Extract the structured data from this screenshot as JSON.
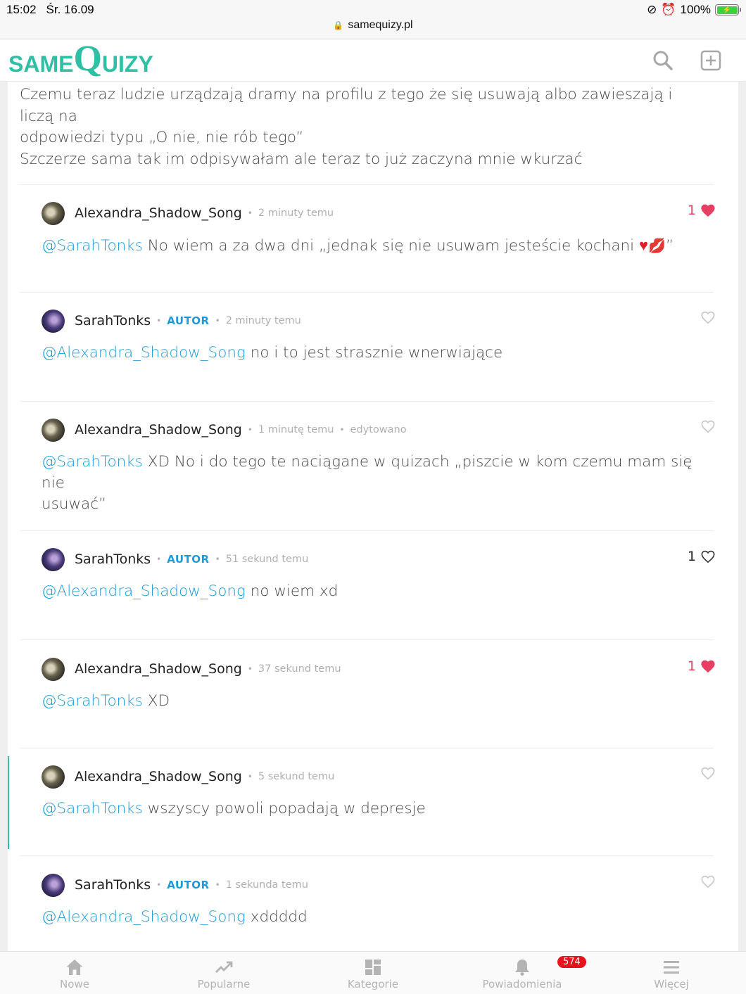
{
  "status_bar": {
    "time": "15:02",
    "date": "Śr. 16.09",
    "battery": "100%",
    "url": "samequizy.pl"
  },
  "header": {
    "logo_same": "SAME",
    "logo_q": "Q",
    "logo_uizy": "UIZY",
    "brand_color": "#2fbfa5"
  },
  "post": {
    "lines": [
      "Czemu teraz ludzie urządzają dramy na profilu z tego że się usuwają albo zawieszają i liczą na",
      "odpowiedzi typu „O nie, nie rób tego”",
      "Szczerze sama tak im odpisywałam ale teraz to już zaczyna mnie wkurzać"
    ]
  },
  "comments": [
    {
      "author": "Alexandra_Shadow_Song",
      "time": "2 minuty temu",
      "mention": "@SarahTonks",
      "text": " No wiem a za dwa dni „jednak się nie usuwam jesteście kochani ",
      "text_end": "”",
      "likes": "1",
      "liked": true
    },
    {
      "author": "SarahTonks",
      "badge": "AUTOR",
      "time": "2 minuty temu",
      "mention": "@Alexandra_Shadow_Song",
      "text": " no i to jest strasznie wnerwiające",
      "likes": "",
      "liked": false
    },
    {
      "author": "Alexandra_Shadow_Song",
      "time": "1 minutę temu",
      "edited": "edytowano",
      "mention": "@SarahTonks",
      "text": " XD No i do tego te naciągane w quizach „piszcie w kom czemu mam się nie\nusuwać”",
      "likes": "",
      "liked": false
    },
    {
      "author": "SarahTonks",
      "badge": "AUTOR",
      "time": "51 sekund temu",
      "mention": "@Alexandra_Shadow_Song",
      "text": " no wiem xd",
      "likes": "1",
      "liked": false
    },
    {
      "author": "Alexandra_Shadow_Song",
      "time": "37 sekund temu",
      "mention": "@SarahTonks",
      "text": " XD",
      "likes": "1",
      "liked": true
    },
    {
      "author": "Alexandra_Shadow_Song",
      "time": "5 sekund temu",
      "mention": "@SarahTonks",
      "text": " wszyscy powoli popadają w depresje",
      "likes": "",
      "liked": false
    },
    {
      "author": "SarahTonks",
      "badge": "AUTOR",
      "time": "1 sekunda temu",
      "mention": "@Alexandra_Shadow_Song",
      "text": " xddddd",
      "likes": "",
      "liked": false
    }
  ],
  "tabbar": {
    "tabs": [
      {
        "label": "Nowe",
        "icon": "home-icon"
      },
      {
        "label": "Popularne",
        "icon": "trending-icon"
      },
      {
        "label": "Kategorie",
        "icon": "grid-icon"
      },
      {
        "label": "Powiadomienia",
        "icon": "bell-icon"
      },
      {
        "label": "Więcej",
        "icon": "menu-icon"
      }
    ],
    "notification_count": "574"
  },
  "colors": {
    "mention": "#1d9bd8",
    "like_active": "#e83e63",
    "notification_badge": "#e8141d"
  }
}
